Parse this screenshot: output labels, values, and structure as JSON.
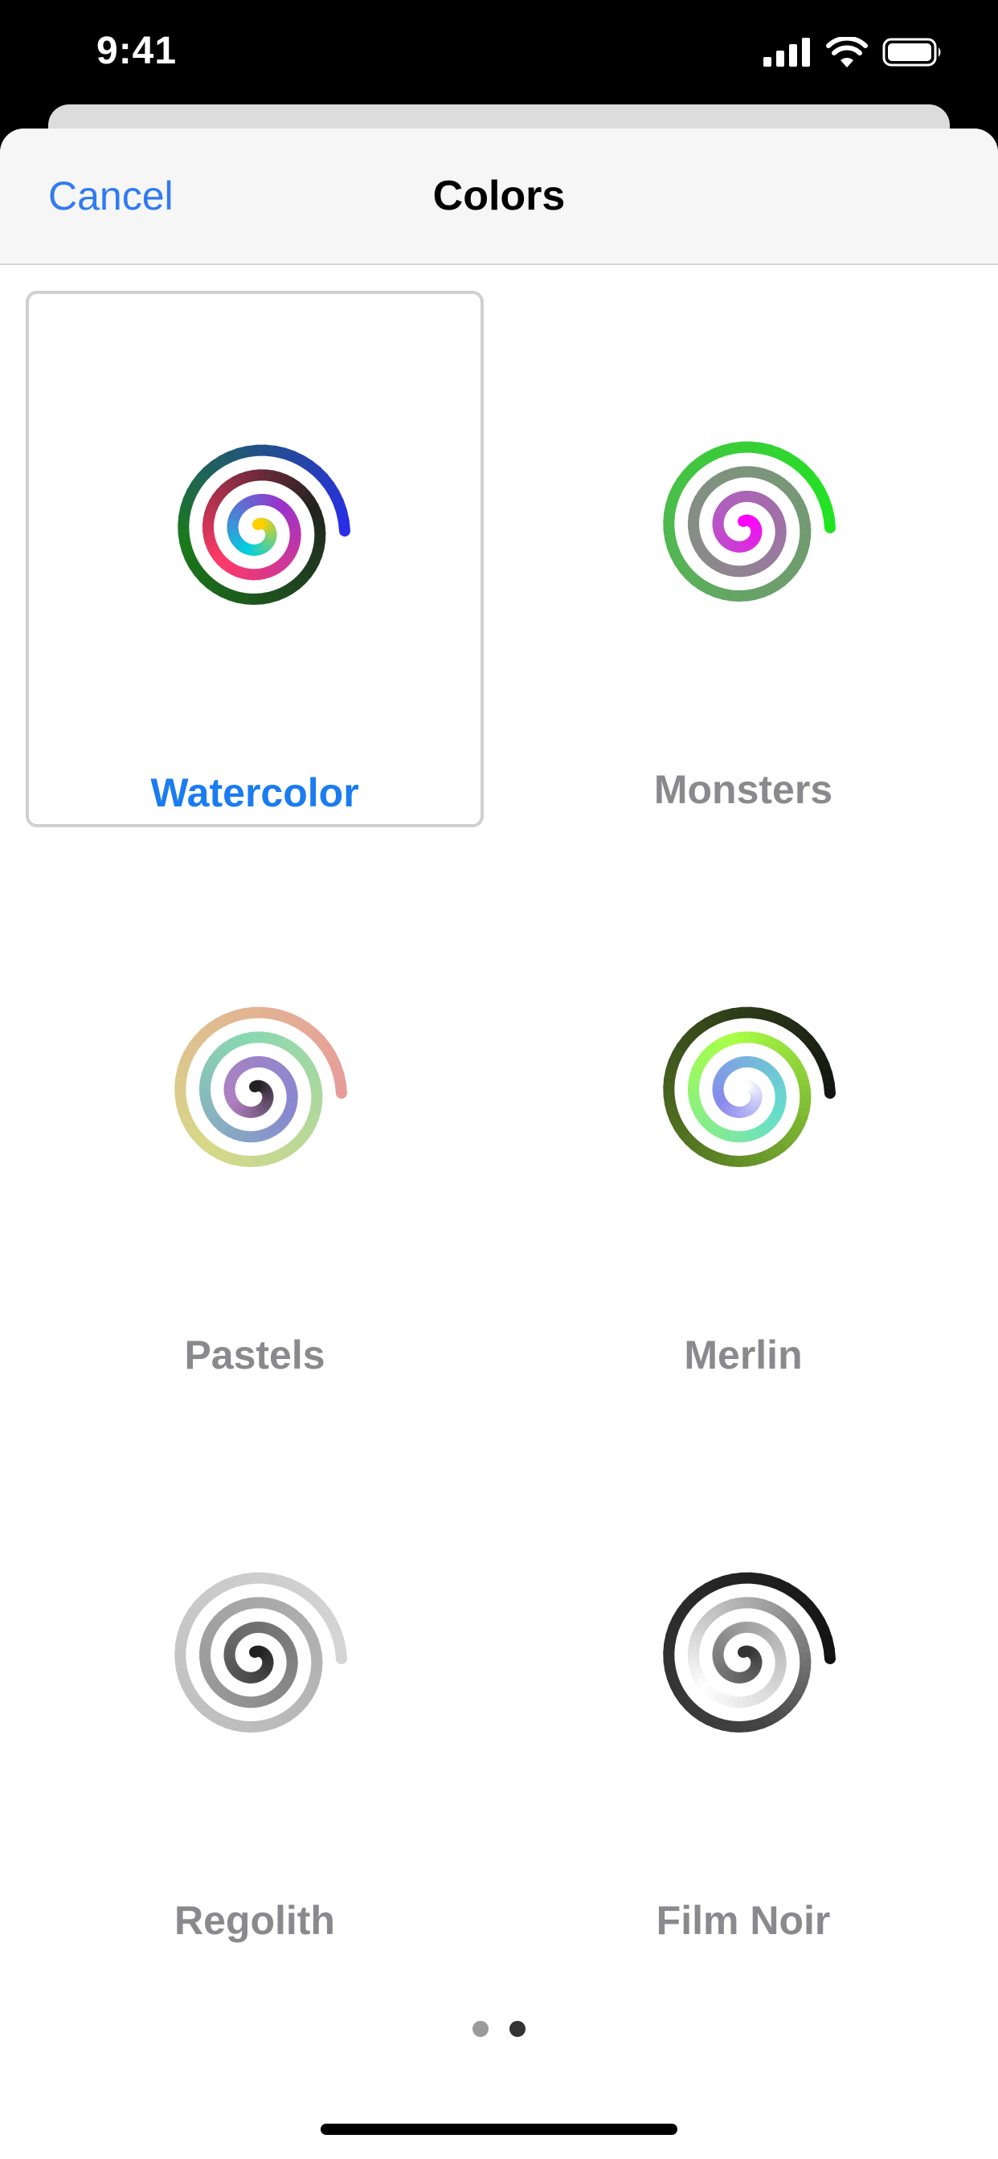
{
  "status_bar": {
    "time": "9:41",
    "icons": [
      "cellular-signal-icon",
      "wifi-icon",
      "battery-icon"
    ]
  },
  "nav": {
    "cancel_label": "Cancel",
    "title": "Colors"
  },
  "palettes": [
    {
      "label": "Watercolor",
      "selected": true,
      "stops": [
        "#2a2af0",
        "#1a7a1a",
        "#222222",
        "#ff3a66",
        "#9933cc",
        "#00cfe0",
        "#ffd000"
      ]
    },
    {
      "label": "Monsters",
      "selected": false,
      "stops": [
        "#1ee61e",
        "#6aa06a",
        "#8a8a8a",
        "#b25cc0",
        "#ff00ff"
      ]
    },
    {
      "label": "Pastels",
      "selected": false,
      "stops": [
        "#e89a9a",
        "#d8d888",
        "#88d8b0",
        "#8888d0",
        "#b080c0",
        "#222222"
      ]
    },
    {
      "label": "Merlin",
      "selected": false,
      "stops": [
        "#111111",
        "#557722",
        "#aaff44",
        "#66ddcc",
        "#8888ee",
        "#ffffff"
      ]
    },
    {
      "label": "Regolith",
      "selected": false,
      "stops": [
        "#d6d6d6",
        "#bbbbbb",
        "#999999",
        "#666666",
        "#222222"
      ]
    },
    {
      "label": "Film Noir",
      "selected": false,
      "stops": [
        "#111111",
        "#444444",
        "#ffffff",
        "#888888",
        "#333333"
      ]
    }
  ],
  "pagination": {
    "pages": 2,
    "current": 2
  },
  "colors": {
    "accent": "#1a7cf0",
    "label_gray": "#8a8a8e",
    "selected_border": "#d0d0d0"
  }
}
